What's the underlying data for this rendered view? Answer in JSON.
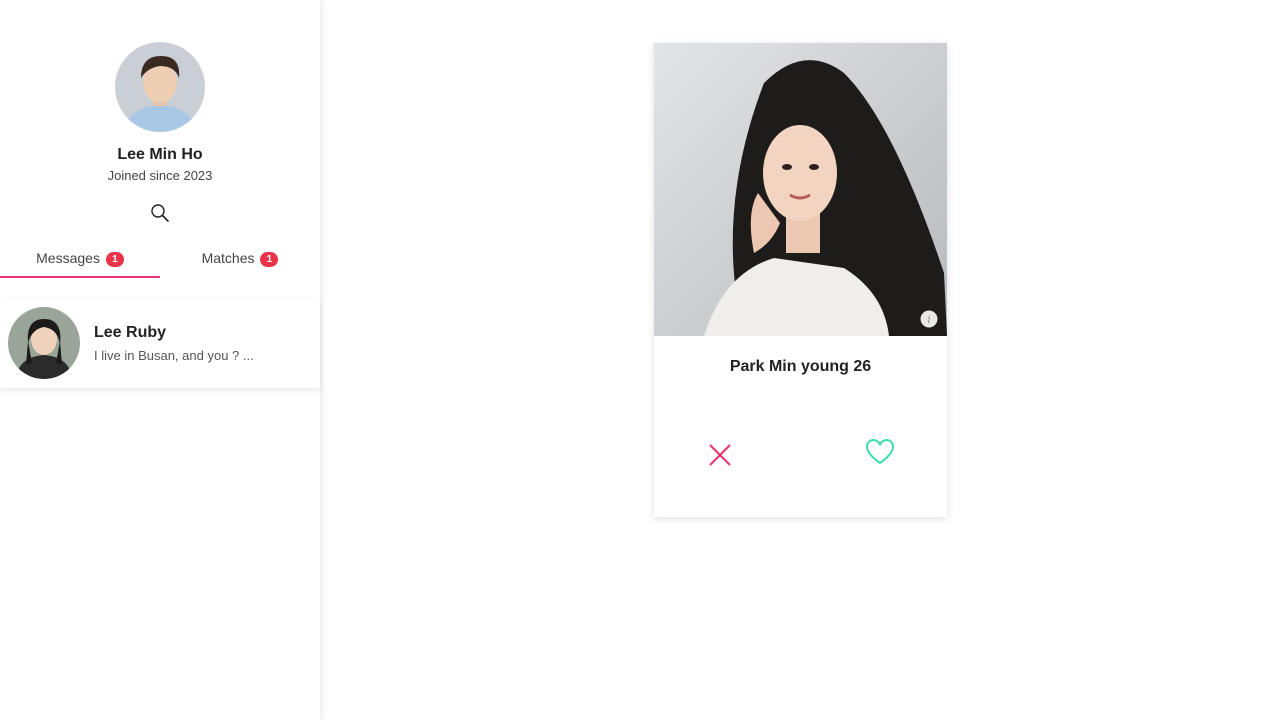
{
  "profile": {
    "name": "Lee Min Ho",
    "joined": "Joined since 2023"
  },
  "tabs": [
    {
      "label": "Messages",
      "badge": "1",
      "active": true
    },
    {
      "label": "Matches",
      "badge": "1",
      "active": false
    }
  ],
  "messages": [
    {
      "name": "Lee Ruby",
      "preview": "I live in Busan, and you ? ..."
    }
  ],
  "card": {
    "name_age": "Park Min young 26"
  },
  "colors": {
    "accent": "#e8336d",
    "badge": "#e8334a",
    "like": "#3ddcb0",
    "nope": "#e8336d"
  },
  "icons": {
    "search": "search-icon",
    "info": "info-icon",
    "nope": "close-icon",
    "like": "heart-icon"
  }
}
